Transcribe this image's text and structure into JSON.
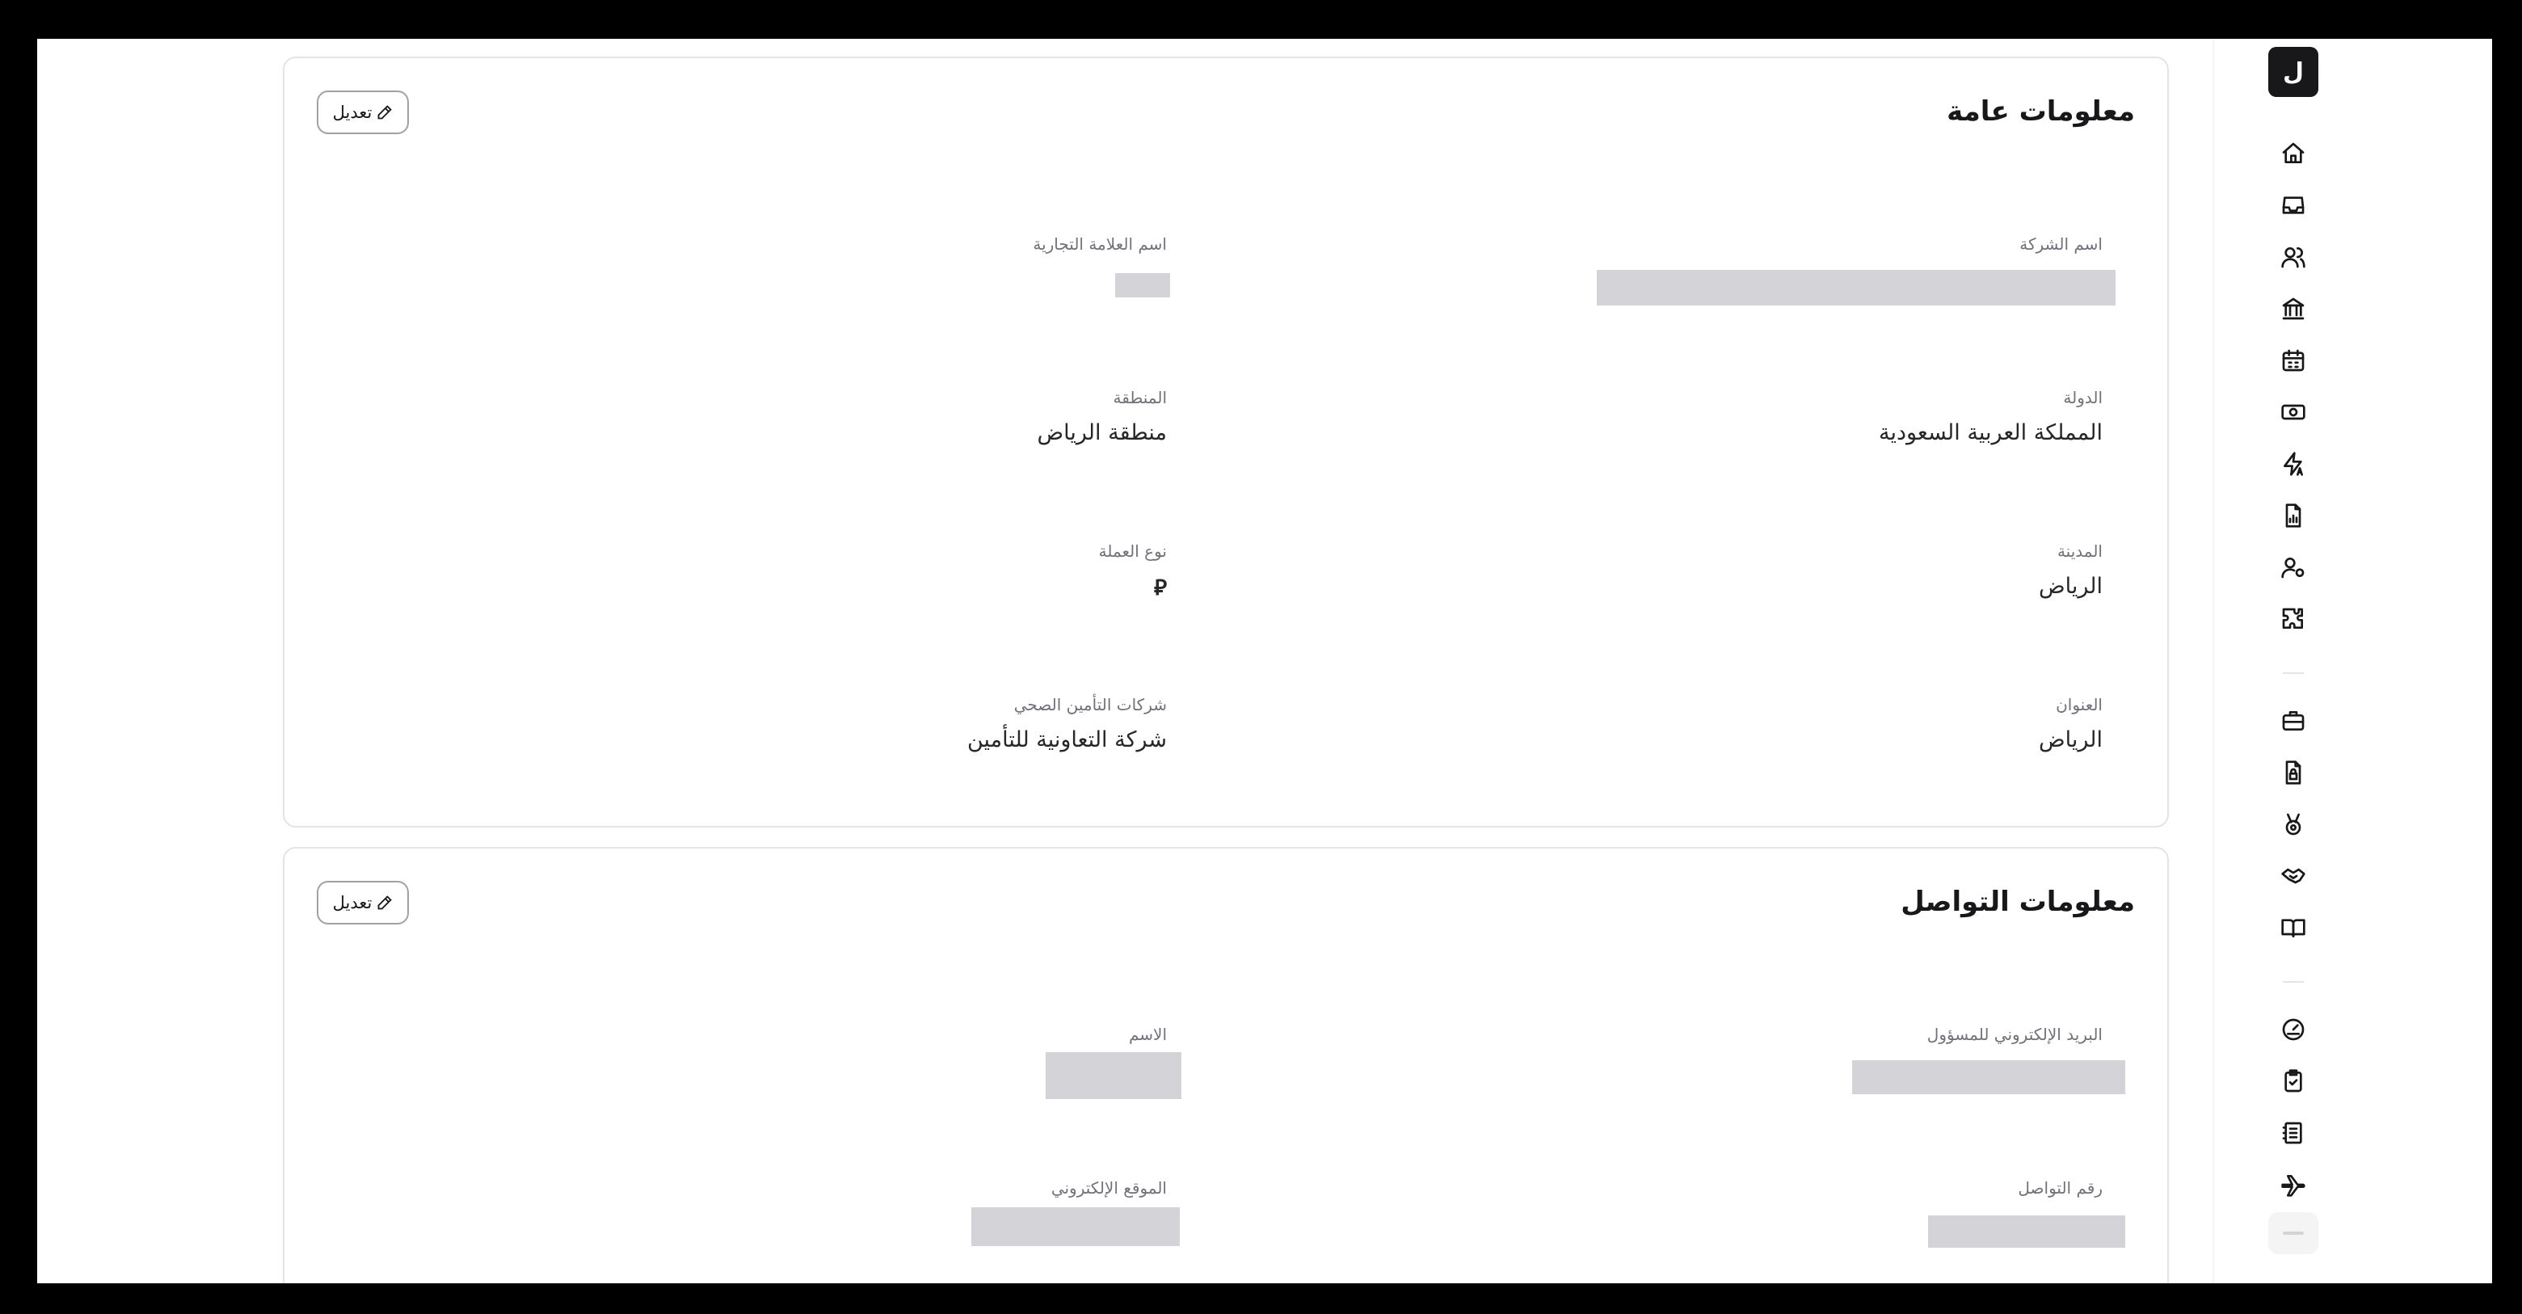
{
  "sidebar": {
    "logo_letter": "ل",
    "icons": [
      "home-icon",
      "inbox-icon",
      "users-icon",
      "bank-icon",
      "calendar-icon",
      "cash-icon",
      "zap-text-icon",
      "file-chart-icon",
      "user-cog-icon",
      "puzzle-icon",
      "briefcase-icon",
      "file-lock-icon",
      "medal-icon",
      "handshake-icon",
      "book-open-icon",
      "gauge-icon",
      "clipboard-check-icon",
      "notebook-icon",
      "plane-icon"
    ]
  },
  "general_info": {
    "title": "معلومات عامة",
    "edit_label": "تعديل",
    "fields": {
      "company_name": {
        "label": "اسم الشركة",
        "value": ""
      },
      "brand_name": {
        "label": "اسم العلامة التجارية",
        "value": ""
      },
      "country": {
        "label": "الدولة",
        "value": "المملكة العربية السعودية"
      },
      "region": {
        "label": "المنطقة",
        "value": "منطقة الرياض"
      },
      "city": {
        "label": "المدينة",
        "value": "الرياض"
      },
      "currency": {
        "label": "نوع العملة",
        "value": "⃁"
      },
      "address": {
        "label": "العنوان",
        "value": "الرياض"
      },
      "insurance": {
        "label": "شركات التأمين الصحي",
        "value": "شركة التعاونية للتأمين"
      }
    }
  },
  "contact_info": {
    "title": "معلومات التواصل",
    "edit_label": "تعديل",
    "fields": {
      "admin_email": {
        "label": "البريد الإلكتروني للمسؤول",
        "value": ""
      },
      "name": {
        "label": "الاسم",
        "value": ""
      },
      "phone": {
        "label": "رقم التواصل",
        "value": ""
      },
      "website": {
        "label": "الموقع الإلكتروني",
        "value": ""
      }
    }
  }
}
